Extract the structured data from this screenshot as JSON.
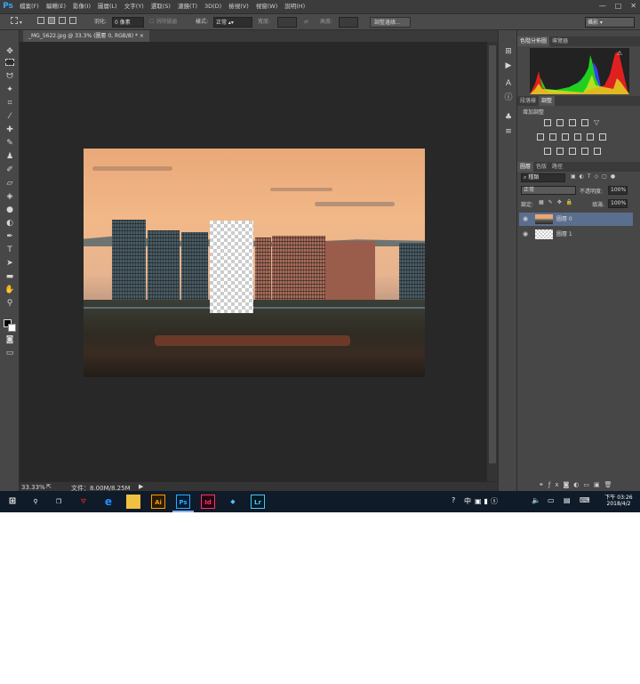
{
  "app": {
    "logo": "Ps"
  },
  "menus": [
    "檔案(F)",
    "編輯(E)",
    "影像(I)",
    "圖層(L)",
    "文字(Y)",
    "選取(S)",
    "濾鏡(T)",
    "3D(D)",
    "檢視(V)",
    "視窗(W)",
    "說明(H)"
  ],
  "window_controls": {
    "minimize": "—",
    "restore": "□",
    "close": "✕"
  },
  "options": {
    "feather_label": "羽化:",
    "feather_value": "0 像素",
    "antialias_label": "消除鋸齒",
    "style_label": "樣式:",
    "style_value": "正常",
    "width_label": "寬度:",
    "height_label": "高度:",
    "refine_button": "調整邊緣...",
    "workspace": "攝影"
  },
  "document": {
    "tab_label": "_MG_5622.jpg @ 33.3% (圖層 0, RGB/8) *",
    "close_label": "×"
  },
  "status": {
    "zoom": "33.33%",
    "doc_size": "文件：8.00M/8.25M"
  },
  "panels": {
    "histogram_tabs": [
      "色階分佈圖",
      "導覽器"
    ],
    "adjust_tabs": [
      "段落樣",
      "調整"
    ],
    "adjust_title": "增加調整",
    "layer_tabs": [
      "圖層",
      "色版",
      "路徑"
    ],
    "layer_filter": "種類",
    "blend_mode": "正常",
    "opacity_label": "不透明度:",
    "opacity_value": "100%",
    "lock_label": "鎖定:",
    "fill_label": "填滿:",
    "fill_value": "100%",
    "layers": [
      {
        "name": "圖層 0",
        "selected": true
      },
      {
        "name": "圖層 1",
        "selected": false
      }
    ]
  },
  "taskbar": {
    "apps": [
      "Ai",
      "Ps",
      "Id",
      "Lr"
    ],
    "ime": "中",
    "time": "下午 03:26",
    "date": "2018/4/2"
  },
  "colors": {
    "accent": "#31a8ff",
    "selected_layer": "#5a6e8e",
    "canvas_bg": "#282828"
  }
}
